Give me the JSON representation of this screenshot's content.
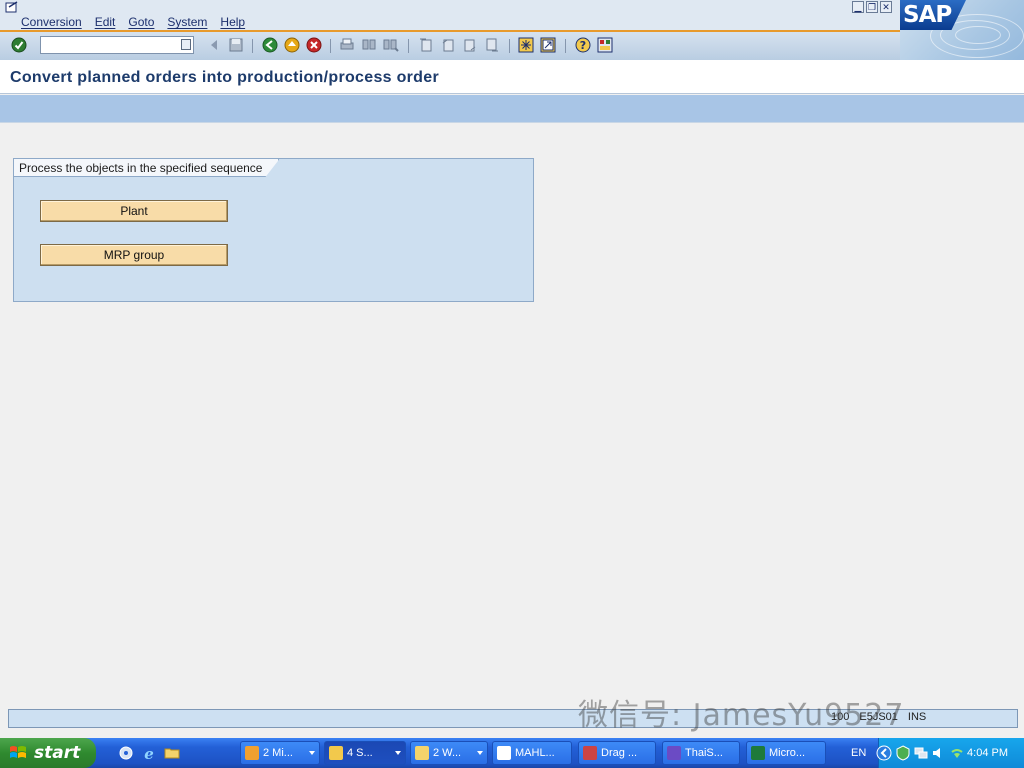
{
  "menubar": {
    "items": [
      "Conversion",
      "Edit",
      "Goto",
      "System",
      "Help"
    ]
  },
  "toolbar": {
    "command_value": "",
    "icons": [
      "enter-icon",
      "back-icon",
      "save-icon",
      "green-back-icon",
      "exit-icon",
      "cancel-icon",
      "print-icon",
      "find-icon",
      "find-next-icon",
      "first-page-icon",
      "prev-page-icon",
      "next-page-icon",
      "last-page-icon",
      "create-session-icon",
      "shortcut-icon",
      "help-icon",
      "customize-layout-icon"
    ]
  },
  "logo": {
    "text": "SAP"
  },
  "screen": {
    "title": "Convert planned orders into production/process order"
  },
  "group": {
    "title": "Process the objects in the specified sequence",
    "buttons": [
      "Plant",
      "MRP group"
    ]
  },
  "statusbar": {
    "client": "100",
    "server": "E5JS01",
    "mode": "INS"
  },
  "watermark": "微信号: JamesYu9527",
  "taskbar": {
    "start_label": "start",
    "tasks": [
      "2 Mi...",
      "4 S...",
      "2 W...",
      "MAHL...",
      "Drag ...",
      "ThaiS...",
      "Micro..."
    ],
    "lang": "EN",
    "clock": "4:04 PM"
  },
  "colors": {
    "accent": "#e89a2c",
    "title_text": "#1d3b6b",
    "button_fill": "#f8dca8",
    "groupbox_fill": "#cddff0",
    "taskbar": "#2360d7"
  }
}
